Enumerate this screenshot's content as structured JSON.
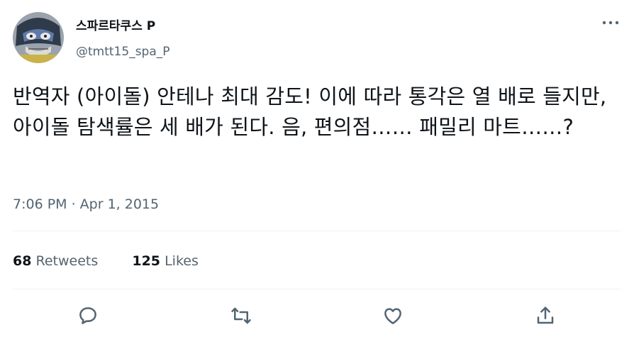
{
  "author": {
    "display_name": "스파르타쿠스 P",
    "handle": "@tmtt15_spa_P"
  },
  "tweet": {
    "text": "반역자 (아이돌) 안테나 최대 감도! 이에 따라 통각은 열 배로 들지만, 아이돌 탐색률은 세 배가 된다. 음, 편의점…… 패밀리 마트……?",
    "timestamp": "7:06 PM · Apr 1, 2015"
  },
  "stats": {
    "retweets_count": "68",
    "retweets_label": "Retweets",
    "likes_count": "125",
    "likes_label": "Likes"
  },
  "icons": {
    "more": "more-icon",
    "reply": "reply-icon",
    "retweet": "retweet-icon",
    "like": "like-icon",
    "share": "share-icon"
  },
  "colors": {
    "text": "#0f1419",
    "secondary": "#536471",
    "divider": "#eff3f4"
  }
}
